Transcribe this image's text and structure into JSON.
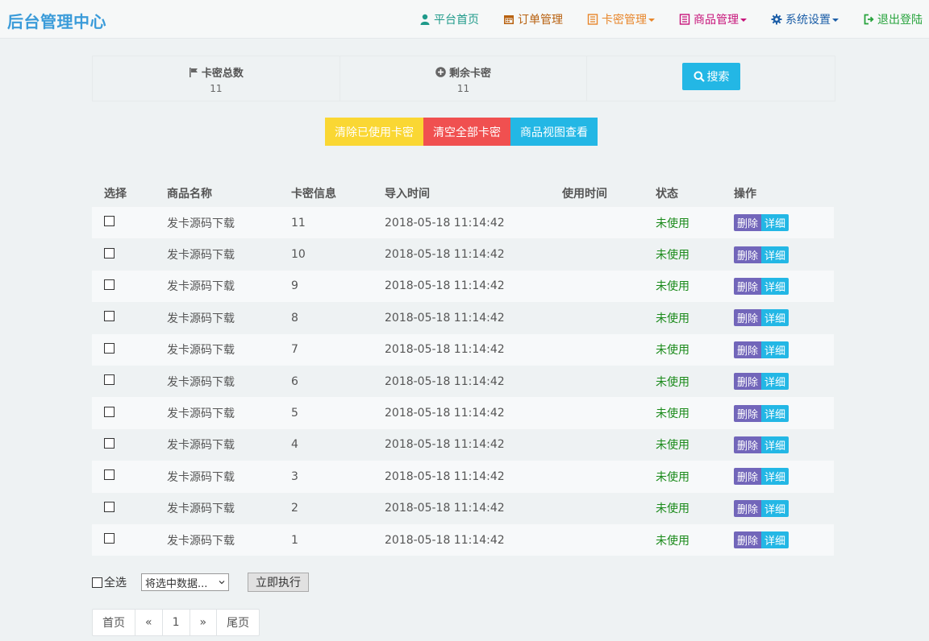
{
  "brand": "后台管理中心",
  "nav": [
    {
      "label": "平台首页",
      "icon": "user-icon",
      "color": "#1f9a8a",
      "dropdown": false
    },
    {
      "label": "订单管理",
      "icon": "calendar-icon",
      "color": "#b8610f",
      "dropdown": false
    },
    {
      "label": "卡密管理",
      "icon": "list-icon",
      "color": "#e8862b",
      "dropdown": true
    },
    {
      "label": "商品管理",
      "icon": "list-icon",
      "color": "#c7147a",
      "dropdown": true
    },
    {
      "label": "系统设置",
      "icon": "gear-icon",
      "color": "#1d5fa8",
      "dropdown": true
    },
    {
      "label": "退出登陆",
      "icon": "logout-icon",
      "color": "#27a33c",
      "dropdown": false
    }
  ],
  "stats": {
    "total_label": "卡密总数",
    "total_value": "11",
    "remaining_label": "剩余卡密",
    "remaining_value": "11",
    "search_label": "搜索"
  },
  "actions": [
    {
      "label": "清除已使用卡密",
      "color": "#fad733"
    },
    {
      "label": "清空全部卡密",
      "color": "#f05050"
    },
    {
      "label": "商品视图查看",
      "color": "#23b7e5"
    }
  ],
  "table": {
    "headers": [
      "选择",
      "商品名称",
      "卡密信息",
      "导入时间",
      "使用时间",
      "状态",
      "操作"
    ],
    "delete_label": "删除",
    "detail_label": "详细",
    "rows": [
      {
        "product": "发卡源码下载",
        "card": "11",
        "imported": "2018-05-18 11:14:42",
        "used": "",
        "status": "未使用"
      },
      {
        "product": "发卡源码下载",
        "card": "10",
        "imported": "2018-05-18 11:14:42",
        "used": "",
        "status": "未使用"
      },
      {
        "product": "发卡源码下载",
        "card": "9",
        "imported": "2018-05-18 11:14:42",
        "used": "",
        "status": "未使用"
      },
      {
        "product": "发卡源码下载",
        "card": "8",
        "imported": "2018-05-18 11:14:42",
        "used": "",
        "status": "未使用"
      },
      {
        "product": "发卡源码下载",
        "card": "7",
        "imported": "2018-05-18 11:14:42",
        "used": "",
        "status": "未使用"
      },
      {
        "product": "发卡源码下载",
        "card": "6",
        "imported": "2018-05-18 11:14:42",
        "used": "",
        "status": "未使用"
      },
      {
        "product": "发卡源码下载",
        "card": "5",
        "imported": "2018-05-18 11:14:42",
        "used": "",
        "status": "未使用"
      },
      {
        "product": "发卡源码下载",
        "card": "4",
        "imported": "2018-05-18 11:14:42",
        "used": "",
        "status": "未使用"
      },
      {
        "product": "发卡源码下载",
        "card": "3",
        "imported": "2018-05-18 11:14:42",
        "used": "",
        "status": "未使用"
      },
      {
        "product": "发卡源码下载",
        "card": "2",
        "imported": "2018-05-18 11:14:42",
        "used": "",
        "status": "未使用"
      },
      {
        "product": "发卡源码下载",
        "card": "1",
        "imported": "2018-05-18 11:14:42",
        "used": "",
        "status": "未使用"
      }
    ]
  },
  "bulk": {
    "select_all_label": "全选",
    "dropdown_value": "将选中数据...",
    "execute_label": "立即执行"
  },
  "pagination": [
    "首页",
    "«",
    "1",
    "»",
    "尾页"
  ]
}
